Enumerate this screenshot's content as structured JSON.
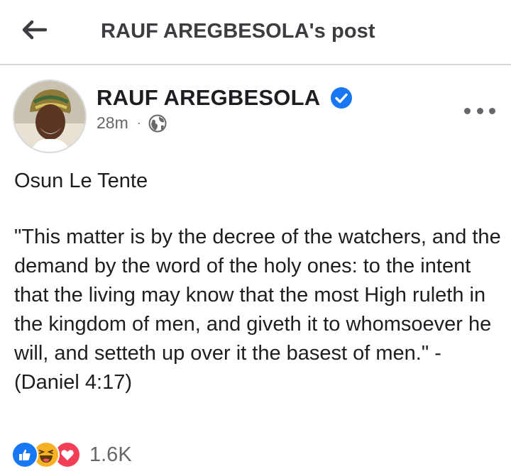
{
  "topbar": {
    "title": "RAUF AREGBESOLA's post",
    "back_icon": "arrow-left-icon"
  },
  "post": {
    "author": "RAUF AREGBESOLA",
    "verified": true,
    "time": "28m",
    "separator": "·",
    "privacy_icon": "globe-icon",
    "title": "Osun Le Tente",
    "body": "\"This matter is by the decree of the watchers, and the demand by the word of the holy ones: to the intent that the living may know that the most High ruleth in the kingdom of men, and giveth it to whomsoever he will, and setteth up over it the basest of men.\" - (Daniel 4:17)"
  },
  "reactions": {
    "icons": [
      "like-icon",
      "haha-icon",
      "love-icon"
    ],
    "count": "1.6K"
  },
  "colors": {
    "verified": "#1877f2",
    "like": "#1877f2",
    "haha": "#f7b125",
    "love": "#f33e58",
    "muted": "#65676b"
  }
}
